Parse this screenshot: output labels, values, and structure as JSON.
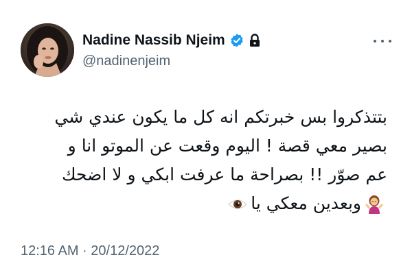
{
  "author": {
    "display_name": "Nadine Nassib Njeim",
    "handle": "@nadinenjeim",
    "verified": true,
    "protected": true
  },
  "tweet": {
    "lines": [
      "بتتذكروا بس خبرتكم انه كل ما يكون عندي شي",
      "بصير معي قصة ! اليوم وقعت عن الموتو انا و",
      "عم صوّر !! بصراحة ما عرفت ابكي و لا اضحك",
      "وبعدين معكي يا"
    ],
    "emojis": [
      "woman-shrugging-emoji",
      "eye-emoji"
    ],
    "timestamp": "12:16 AM · 20/12/2022"
  },
  "colors": {
    "text_primary": "#0f1419",
    "text_secondary": "#536471",
    "verified_blue": "#1d9bf0"
  },
  "icons": [
    "verified-badge-icon",
    "lock-icon",
    "more-options-icon"
  ]
}
